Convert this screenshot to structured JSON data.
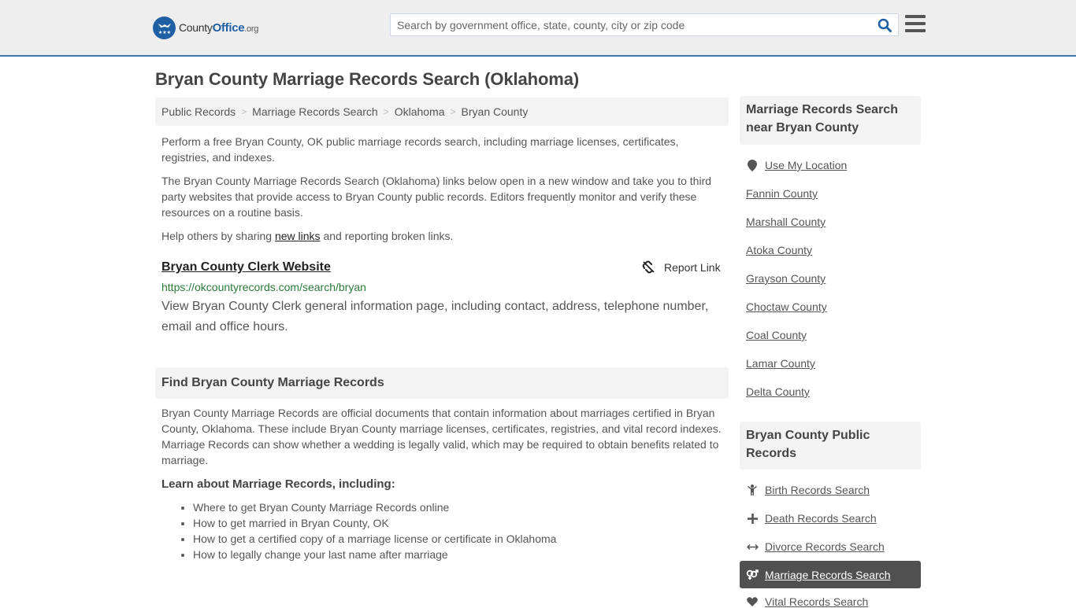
{
  "header": {
    "logo": {
      "text_main": "County",
      "text_bold": "Office",
      "text_suffix": ".org",
      "icon": "eagle-stars-badge-icon"
    },
    "search": {
      "placeholder": "Search by government office, state, county, city or zip code",
      "value": "",
      "icon": "search-icon"
    },
    "menu_icon": "hamburger-menu-icon"
  },
  "page": {
    "title": "Bryan County Marriage Records Search (Oklahoma)",
    "breadcrumb": [
      "Public Records",
      "Marriage Records Search",
      "Oklahoma",
      "Bryan County"
    ],
    "breadcrumb_separator": ">",
    "intro": "Perform a free Bryan County, OK public marriage records search, including marriage licenses, certificates, registries, and indexes.",
    "disclaimer": "The Bryan County Marriage Records Search (Oklahoma) links below open in a new window and take you to third party websites that provide access to Bryan County public records. Editors frequently monitor and verify these resources on a routine basis.",
    "help": {
      "before": "Help others by sharing ",
      "link": "new links",
      "after": " and reporting broken links."
    }
  },
  "listing": {
    "title": "Bryan County Clerk Website",
    "url": "https://okcountyrecords.com/search/bryan",
    "description": "View Bryan County Clerk general information page, including contact, address, telephone number, email and office hours.",
    "report_label": "Report Link",
    "report_icon": "broken-link-icon"
  },
  "find_section": {
    "heading": "Find Bryan County Marriage Records",
    "body": "Bryan County Marriage Records are official documents that contain information about marriages certified in Bryan County, Oklahoma. These include Bryan County marriage licenses, certificates, registries, and vital record indexes. Marriage Records can show whether a wedding is legally valid, which may be required to obtain benefits related to marriage.",
    "learn_heading": "Learn about Marriage Records, including:",
    "learn_items": [
      "Where to get Bryan County Marriage Records online",
      "How to get married in Bryan County, OK",
      "How to get a certified copy of a marriage license or certificate in Oklahoma",
      "How to legally change your last name after marriage"
    ]
  },
  "sidebar": {
    "nearby_heading": "Marriage Records Search near Bryan County",
    "use_location": "Use My Location",
    "nearby": [
      "Fannin County",
      "Marshall County",
      "Atoka County",
      "Grayson County",
      "Choctaw County",
      "Coal County",
      "Lamar County",
      "Delta County"
    ],
    "public_heading": "Bryan County Public Records",
    "public_links": [
      {
        "label": "Birth Records Search",
        "icon": "child-icon",
        "active": false
      },
      {
        "label": "Death Records Search",
        "icon": "cross-icon",
        "active": false
      },
      {
        "label": "Divorce Records Search",
        "icon": "arrows-horizontal-icon",
        "active": false
      },
      {
        "label": "Marriage Records Search",
        "icon": "venus-mars-icon",
        "active": true
      },
      {
        "label": "Vital Records Search",
        "icon": "heartbeat-icon",
        "active": false
      }
    ]
  },
  "colors": {
    "brand_blue": "#1f5fa3",
    "header_border": "#3b7bb0",
    "url_green": "#2a7a3a",
    "active_bg": "#505050"
  }
}
